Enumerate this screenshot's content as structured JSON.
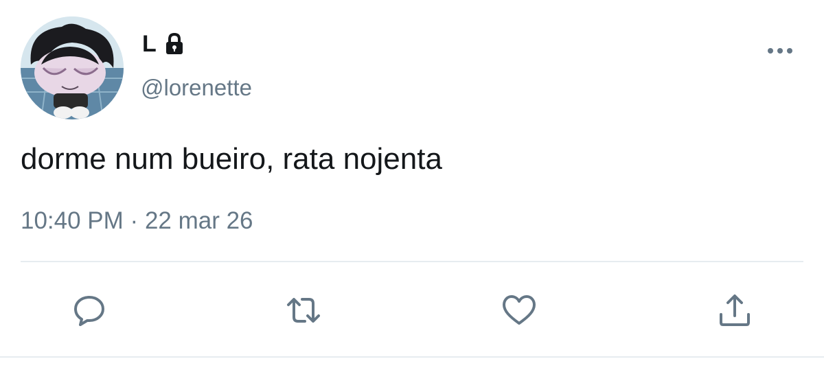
{
  "author": {
    "display_name": "L",
    "handle": "@lorenette",
    "protected": true
  },
  "tweet": {
    "text": "dorme num bueiro, rata nojenta",
    "time": "10:40 PM",
    "separator": "·",
    "date": "22 mar 26"
  },
  "icons": {
    "more": "more-horizontal-icon",
    "reply": "reply-icon",
    "retweet": "retweet-icon",
    "like": "heart-icon",
    "share": "share-icon",
    "lock": "lock-icon"
  },
  "colors": {
    "text_primary": "#14171a",
    "text_secondary": "#657786",
    "divider": "#e6ecf0"
  }
}
